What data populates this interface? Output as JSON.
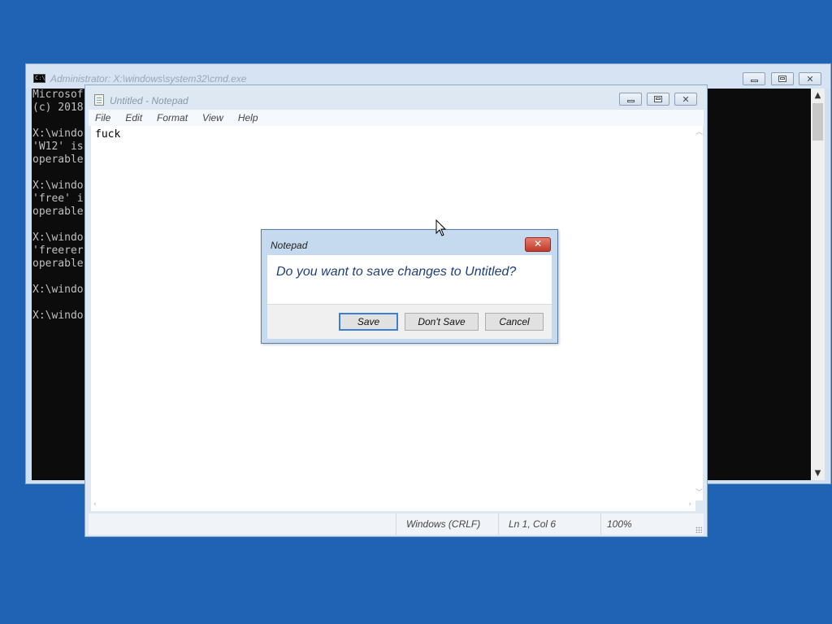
{
  "cmd": {
    "title": "Administrator: X:\\windows\\system32\\cmd.exe",
    "icon_text": "C:\\",
    "lines": [
      "Microsof",
      "(c) 2018",
      "",
      "X:\\windo",
      "'W12' is",
      "operable",
      "",
      "X:\\windo",
      "'free' i",
      "operable",
      "",
      "X:\\windo",
      "'freerer",
      "operable",
      "",
      "X:\\windo",
      "",
      "X:\\windo"
    ]
  },
  "notepad": {
    "title": "Untitled - Notepad",
    "menu": [
      "File",
      "Edit",
      "Format",
      "View",
      "Help"
    ],
    "content": "fuck",
    "status": {
      "line_endings": "Windows (CRLF)",
      "position": "Ln 1, Col 6",
      "zoom": "100%"
    }
  },
  "dialog": {
    "title": "Notepad",
    "message": "Do you want to save changes to Untitled?",
    "buttons": {
      "save": "Save",
      "dont_save": "Don't Save",
      "cancel": "Cancel"
    }
  },
  "colors": {
    "desktop": "#1f64b4",
    "console_bg": "#0c0c0c",
    "console_text": "#c0c0c0",
    "dialog_message": "#1e3f7a",
    "close_button": "#c0392b"
  }
}
